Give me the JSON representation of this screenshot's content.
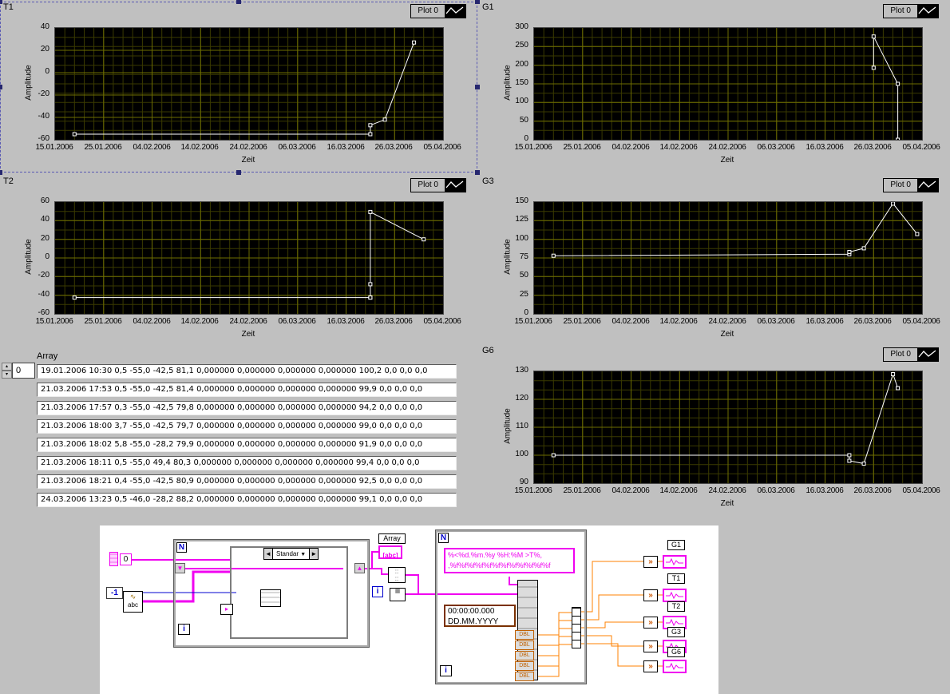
{
  "colors": {
    "magenta": "#f000f0",
    "orange": "#ff8200",
    "blue_wire": "#0000d0",
    "brown": "#7a3000",
    "grid_minor": "#3a3a00",
    "grid_major": "#6e6e00",
    "plot_line": "#ffffff",
    "panel_bg": "#c0c0c0"
  },
  "chart_data": [
    {
      "id": "T1",
      "type": "line",
      "title": "T1",
      "legend_label": "Plot 0",
      "ylabel": "Amplitude",
      "xlabel": "Zeit",
      "ylim": [
        -60,
        40
      ],
      "yticks": [
        40,
        20,
        0,
        -20,
        -40,
        -60
      ],
      "xticks": [
        "15.01.2006",
        "25.01.2006",
        "04.02.2006",
        "14.02.2006",
        "24.02.2006",
        "06.03.2006",
        "16.03.2006",
        "26.03.2006",
        "05.04.2006"
      ],
      "points": [
        [
          "19.01.2006",
          -55
        ],
        [
          "21.03.2006",
          -55
        ],
        [
          "21.03.2006",
          -47
        ],
        [
          "24.03.2006",
          -42
        ],
        [
          "30.03.2006",
          27
        ]
      ],
      "grid": true,
      "legend_position": "top-right",
      "selected": true
    },
    {
      "id": "G1",
      "type": "line",
      "title": "G1",
      "legend_label": "Plot 0",
      "ylabel": "Amplitude",
      "xlabel": "Zeit",
      "ylim": [
        0,
        300
      ],
      "yticks": [
        300,
        250,
        200,
        150,
        100,
        50,
        0
      ],
      "xticks": [
        "15.01.2006",
        "25.01.2006",
        "04.02.2006",
        "14.02.2006",
        "24.02.2006",
        "06.03.2006",
        "16.03.2006",
        "26.03.2006",
        "05.04.2006"
      ],
      "points": [
        [
          "26.03.2006",
          193
        ],
        [
          "26.03.2006",
          277
        ],
        [
          "31.03.2006",
          150
        ],
        [
          "31.03.2006",
          0
        ]
      ],
      "grid": true,
      "legend_position": "top-right",
      "selected": false
    },
    {
      "id": "T2",
      "type": "line",
      "title": "T2",
      "legend_label": "Plot 0",
      "ylabel": "Amplitude",
      "xlabel": "Zeit",
      "ylim": [
        -60,
        60
      ],
      "yticks": [
        60,
        40,
        20,
        0,
        -20,
        -40,
        -60
      ],
      "xticks": [
        "15.01.2006",
        "25.01.2006",
        "04.02.2006",
        "14.02.2006",
        "24.02.2006",
        "06.03.2006",
        "16.03.2006",
        "26.03.2006",
        "05.04.2006"
      ],
      "points": [
        [
          "19.01.2006",
          -42.5
        ],
        [
          "21.03.2006",
          -42.5
        ],
        [
          "21.03.2006",
          -28.2
        ],
        [
          "21.03.2006",
          -42.5
        ],
        [
          "21.03.2006",
          49.4
        ],
        [
          "01.04.2006",
          20
        ]
      ],
      "grid": true,
      "legend_position": "top-right",
      "selected": false
    },
    {
      "id": "G3",
      "type": "line",
      "title": "G3",
      "legend_label": "Plot 0",
      "ylabel": "Amplitude",
      "xlabel": "Zeit",
      "ylim": [
        0,
        150
      ],
      "yticks": [
        150,
        125,
        100,
        75,
        50,
        25,
        0
      ],
      "xticks": [
        "15.01.2006",
        "25.01.2006",
        "04.02.2006",
        "14.02.2006",
        "24.02.2006",
        "06.03.2006",
        "16.03.2006",
        "26.03.2006",
        "05.04.2006"
      ],
      "points": [
        [
          "19.01.2006",
          78
        ],
        [
          "21.03.2006",
          80
        ],
        [
          "21.03.2006",
          83
        ],
        [
          "24.03.2006",
          88
        ],
        [
          "30.03.2006",
          148
        ],
        [
          "04.04.2006",
          107
        ]
      ],
      "grid": true,
      "legend_position": "top-right",
      "selected": false
    },
    {
      "id": "G6",
      "type": "line",
      "title": "G6",
      "legend_label": "Plot 0",
      "ylabel": "Amplitude",
      "xlabel": "Zeit",
      "ylim": [
        90,
        130
      ],
      "yticks": [
        130,
        120,
        110,
        100,
        90
      ],
      "xticks": [
        "15.01.2006",
        "25.01.2006",
        "04.02.2006",
        "14.02.2006",
        "24.02.2006",
        "06.03.2006",
        "16.03.2006",
        "26.03.2006",
        "05.04.2006"
      ],
      "points": [
        [
          "19.01.2006",
          100
        ],
        [
          "21.03.2006",
          100
        ],
        [
          "21.03.2006",
          98
        ],
        [
          "24.03.2006",
          97
        ],
        [
          "30.03.2006",
          129
        ],
        [
          "31.03.2006",
          124
        ]
      ],
      "grid": true,
      "legend_position": "top-right",
      "selected": false
    }
  ],
  "array_panel": {
    "label": "Array",
    "index_value": "0",
    "rows": [
      "19.01.2006 10:30 0,5 -55,0 -42,5 81,1 0,000000 0,000000 0,000000 0,000000 100,2 0,0 0,0 0,0",
      "21.03.2006 17:53 0,5 -55,0 -42,5 81,4 0,000000 0,000000 0,000000 0,000000 99,9 0,0 0,0 0,0",
      "21.03.2006 17:57 0,3 -55,0 -42,5 79,8 0,000000 0,000000 0,000000 0,000000 94,2 0,0 0,0 0,0",
      "21.03.2006 18:00 3,7 -55,0 -42,5 79,7 0,000000 0,000000 0,000000 0,000000 99,0 0,0 0,0 0,0",
      "21.03.2006 18:02 5,8 -55,0 -28,2 79,9 0,000000 0,000000 0,000000 0,000000 91,9 0,0 0,0 0,0",
      "21.03.2006 18:11 0,5 -55,0 49,4 80,3 0,000000 0,000000 0,000000 0,000000 99,4 0,0 0,0 0,0",
      "21.03.2006 18:21 0,4 -55,0 -42,5 80,9 0,000000 0,000000 0,000000 0,000000 92,5 0,0 0,0 0,0",
      "24.03.2006 13:23 0,5 -46,0 -28,2 88,2 0,000000 0,000000 0,000000 0,000000 99,1 0,0 0,0 0,0"
    ]
  },
  "diagram": {
    "loop1_n": "N",
    "loop1_i": "i",
    "loop2_n": "N",
    "loop2_i": "i",
    "ring_label": "Standar",
    "const_zero": "0",
    "const_neg1": "-1",
    "str_icon_label": "abc",
    "array_terminal_label": "Array",
    "array_terminal_glyph": "[abc]",
    "format_string_line1": "%<%d.%m.%y %H:%M >T%,",
    "format_string_line2": ",%f%f%f%f%f%f%f%f%f%f%f%f",
    "time_const_line1": "00:00:00.000",
    "time_const_line2": "DD.MM.YYYY",
    "dbl_label": "DBL",
    "terminals": [
      {
        "label": "G1"
      },
      {
        "label": "T1"
      },
      {
        "label": "T2"
      },
      {
        "label": "G3"
      },
      {
        "label": "G6"
      }
    ]
  }
}
